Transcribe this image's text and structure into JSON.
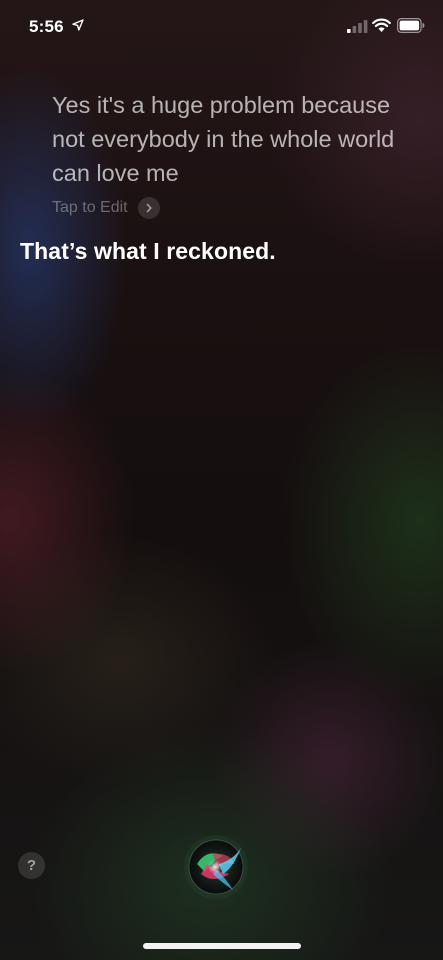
{
  "status_bar": {
    "time": "5:56",
    "icons": [
      "location-arrow-icon",
      "cellular-signal-icon",
      "wifi-icon",
      "battery-icon"
    ]
  },
  "conversation": {
    "query": "Yes it's a huge problem because not everybody in the whole world can love me",
    "tap_to_edit": "Tap to Edit",
    "response": "That’s what I reckoned."
  },
  "controls": {
    "help_label": "?",
    "siri_button_icon": "siri-orb-icon"
  },
  "colors": {
    "background": "#1a1011",
    "text_primary": "#ffffff",
    "text_query": "rgba(255,255,255,0.68)",
    "text_muted": "rgba(255,255,255,0.35)"
  }
}
